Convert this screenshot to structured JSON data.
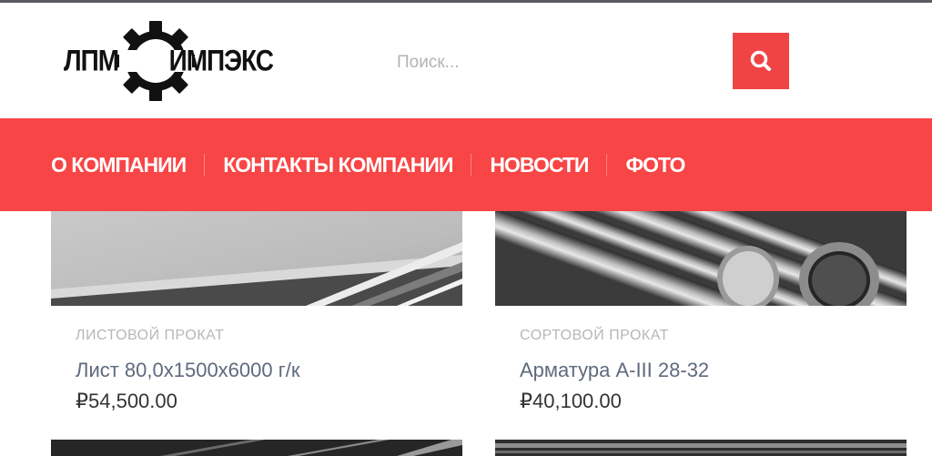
{
  "header": {
    "logo": {
      "left_text": "ЛПМ",
      "right_text": "ИМПЭКС",
      "icon": "gear-icon"
    },
    "search": {
      "placeholder": "Поиск...",
      "icon": "search-icon"
    }
  },
  "nav": {
    "items": [
      {
        "label": "О КОМПАНИИ"
      },
      {
        "label": "КОНТАКТЫ КОМПАНИИ"
      },
      {
        "label": "НОВОСТИ"
      },
      {
        "label": "ФОТО"
      }
    ]
  },
  "products": [
    {
      "category": "ЛИСТОВОЙ ПРОКАТ",
      "title": "Лист 80,0х1500х6000 г/к",
      "price": "₽54,500.00"
    },
    {
      "category": "СОРТОВОЙ ПРОКАТ",
      "title": "Арматура А-III 28-32",
      "price": "₽40,100.00"
    }
  ],
  "colors": {
    "accent": "#f84545",
    "button": "#f04444",
    "title": "#5f6a7d",
    "category": "#b7b7b7"
  }
}
